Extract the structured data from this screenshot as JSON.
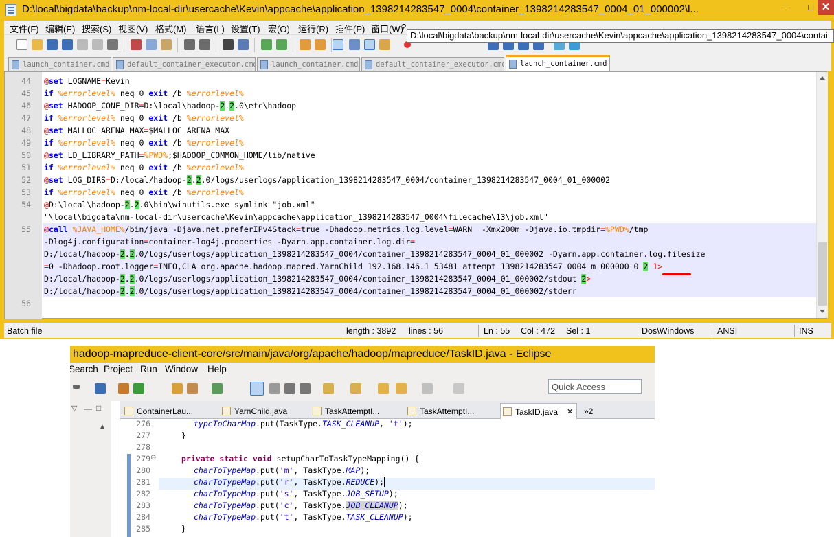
{
  "npp": {
    "title": "D:\\local\\bigdata\\backup\\nm-local-dir\\usercache\\Kevin\\appcache\\application_1398214283547_0004\\container_1398214283547_0004_01_000002\\l...",
    "window_buttons": {
      "minimize": "—",
      "maximize": "□",
      "close": "✕"
    },
    "menu": [
      "文件(F)",
      "编辑(E)",
      "搜索(S)",
      "视图(V)",
      "格式(M)",
      "语言(L)",
      "设置(T)",
      "宏(O)",
      "运行(R)",
      "插件(P)",
      "窗口(W)",
      "?"
    ],
    "tooltip": "D:\\local\\bigdata\\backup\\nm-local-dir\\usercache\\Kevin\\appcache\\application_1398214283547_0004\\contai",
    "tabs": [
      "launch_container.cmd",
      "default_container_executor.cmd",
      "launch_container.cmd",
      "default_container_executor.cmd",
      "launch_container.cmd"
    ],
    "line_numbers": [
      "44",
      "45",
      "46",
      "47",
      "48",
      "49",
      "50",
      "51",
      "52",
      "53",
      "54",
      "55",
      "56"
    ],
    "status": {
      "type": "Batch file",
      "length": "length : 3892",
      "lines": "lines : 56",
      "ln": "Ln : 55",
      "col": "Col : 472",
      "sel": "Sel : 1",
      "eol": "Dos\\Windows",
      "encoding": "ANSI",
      "mode": "INS"
    }
  },
  "eclipse": {
    "title": "hadoop-mapreduce-client-core/src/main/java/org/apache/hadoop/mapreduce/TaskID.java - Eclipse",
    "menu": [
      "Search",
      "Project",
      "Run",
      "Window",
      "Help"
    ],
    "quick_access_placeholder": "Quick Access",
    "tabs": [
      "ContainerLau...",
      "YarnChild.java",
      "TaskAttemptI...",
      "TaskAttemptI...",
      "TaskID.java",
      "»2"
    ],
    "line_numbers": [
      "276",
      "277",
      "278",
      "279",
      "280",
      "281",
      "282",
      "283",
      "284",
      "285"
    ],
    "code": [
      "typeToCharMap.put(TaskType.TASK_CLEANUP, 't');",
      "}",
      "",
      "private static void setupCharToTaskTypeMapping() {",
      "charToTypeMap.put('m', TaskType.MAP);",
      "charToTypeMap.put('r', TaskType.REDUCE);",
      "charToTypeMap.put('s', TaskType.JOB_SETUP);",
      "charToTypeMap.put('c', TaskType.JOB_CLEANUP);",
      "charToTypeMap.put('t', TaskType.TASK_CLEANUP);",
      "}"
    ]
  },
  "colors": {
    "title_bar": "#f1c21b",
    "highlight_line": "#e8e8ff",
    "keyword_blue": "#0000ff",
    "var_orange": "#ff8000",
    "brace_match": "#5fe05f",
    "red_underline": "#e00000"
  }
}
